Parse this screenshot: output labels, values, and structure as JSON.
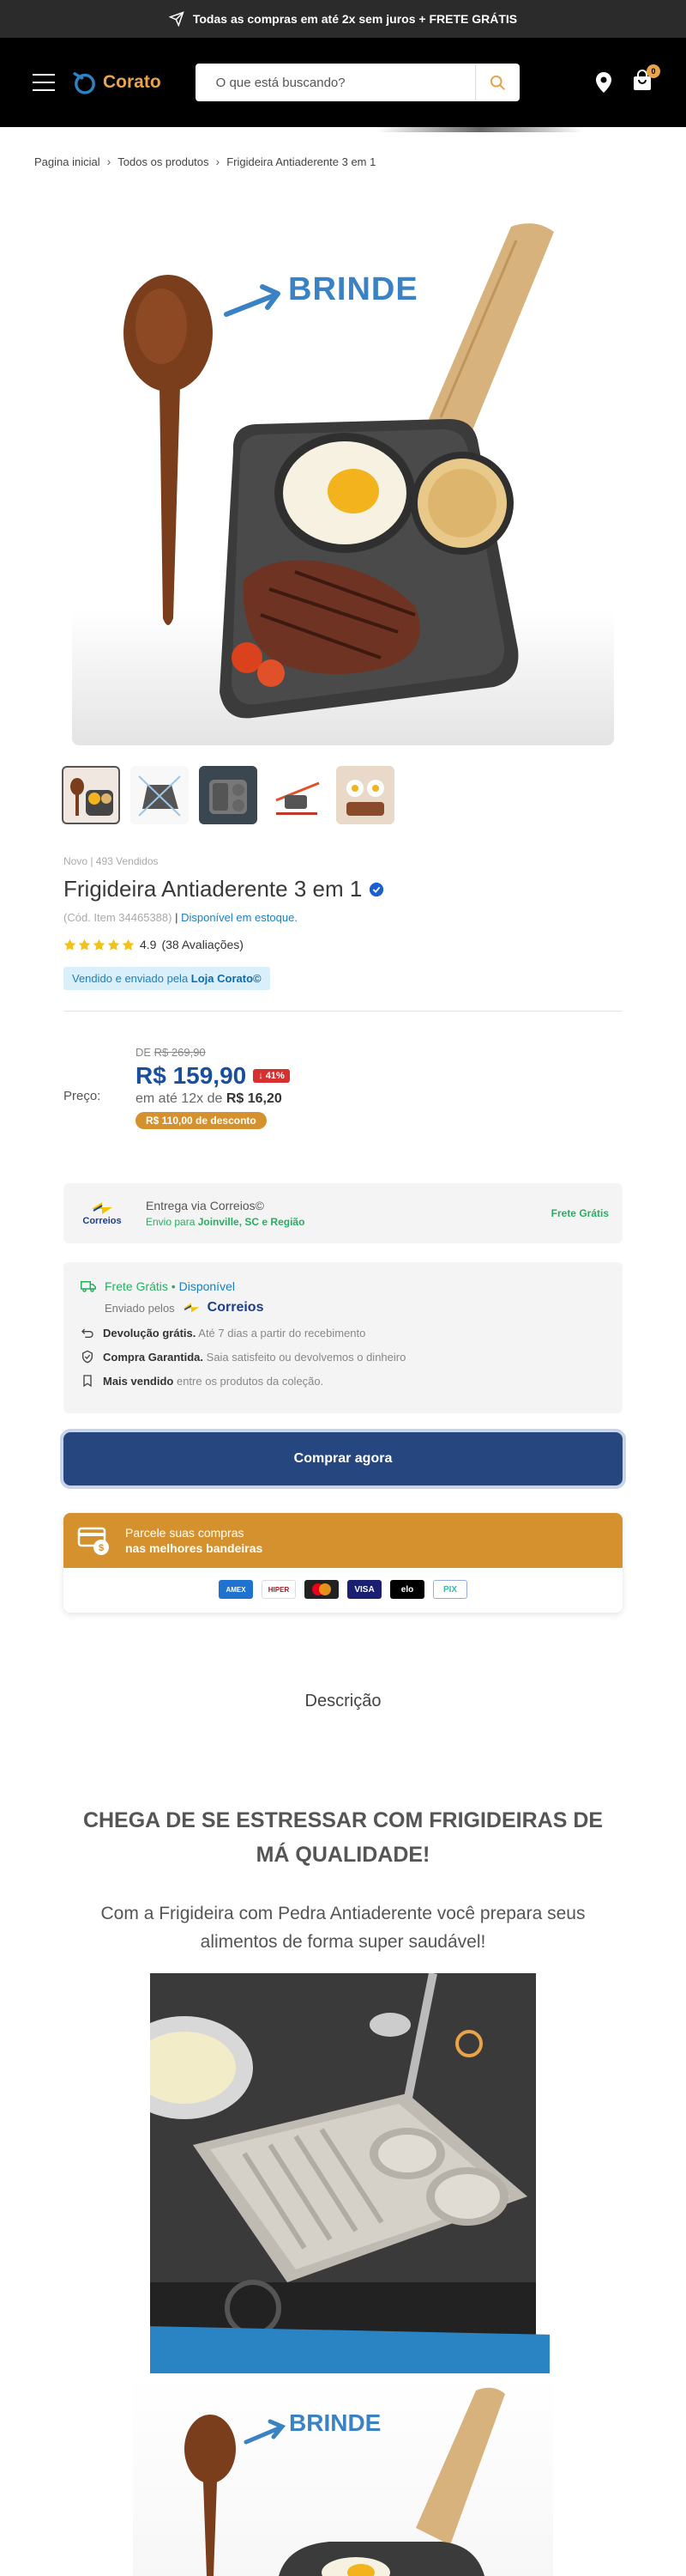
{
  "announcement": {
    "text": "Todas as compras em até 2x sem juros + FRETE GRÁTIS"
  },
  "header": {
    "logo_text": "Corato",
    "search_placeholder": "O que está buscando?",
    "cart_count": "0"
  },
  "breadcrumb": [
    "Pagina inicial",
    "Todos os produtos",
    "Frigideira Antiaderente 3 em 1"
  ],
  "main_image": {
    "overlay_text": "BRINDE"
  },
  "product": {
    "meta": "Novo | 493 Vendidos",
    "title": "Frigideira Antiaderente 3 em 1",
    "sku": "(Cód. Item 34465388)",
    "sku_sep": " | ",
    "stock": "Disponível em estoque.",
    "rating_value": "4.9",
    "rating_count": "(38 Avaliações)",
    "seller_prefix": "Vendido e enviado pela ",
    "seller_name": "Loja Corato©"
  },
  "price": {
    "label": "Preço:",
    "old_prefix": "DE ",
    "old_value": "R$ 269,90",
    "new_value": "R$ 159,90",
    "discount": "41%",
    "installments_prefix": "em até 12x de ",
    "installments_value": "R$ 16,20",
    "savings": "R$ 110,00 de desconto"
  },
  "shipping": {
    "logo_label": "Correios",
    "title": "Entrega via Correios©",
    "sub_prefix": "Envio para ",
    "sub_region": "Joinville, SC e Região",
    "free": "Frete Grátis"
  },
  "benefits": {
    "free_shipping": "Frete Grátis",
    "bullet": " • ",
    "available": "Disponível",
    "sent_by": "Enviado pelos",
    "correios": "Correios",
    "rows": [
      {
        "bold": "Devolução grátis.",
        "text": " Até 7 dias a partir do recebimento"
      },
      {
        "bold": "Compra Garantida.",
        "text": " Saia satisfeito ou devolvemos o dinheiro"
      },
      {
        "bold": "Mais vendido",
        "text": " entre os produtos da coleção."
      }
    ]
  },
  "buy_button": "Comprar agora",
  "parcel": {
    "line1": "Parcele suas compras",
    "line2": "nas melhores bandeiras",
    "cards": [
      "AMEX",
      "HIPER",
      "MC",
      "VISA",
      "elo",
      "PIX"
    ]
  },
  "description": {
    "title": "Descrição",
    "headline": "CHEGA DE SE ESTRESSAR COM FRIGIDEIRAS DE MÁ QUALIDADE!",
    "subline": "Com a Frigideira com Pedra Antiaderente você prepara seus alimentos de forma super saudável!",
    "image2_text": "BRINDE"
  },
  "colors": {
    "brand_navy": "#26467f",
    "accent_orange": "#d4912e",
    "price_blue": "#1a4fa0",
    "success_green": "#27ae60",
    "discount_red": "#d63031"
  }
}
